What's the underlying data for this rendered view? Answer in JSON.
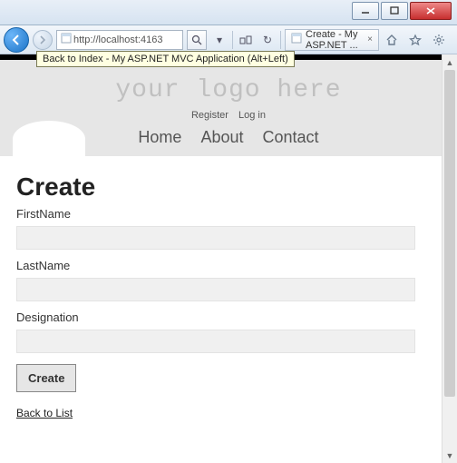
{
  "window": {
    "min": "—",
    "max": "□",
    "close": "×"
  },
  "toolbar": {
    "url": "http://localhost:4163",
    "search_glyph": "🔍",
    "refresh": "↻",
    "tab_title": "Create - My ASP.NET ...",
    "tab_close": "×",
    "tooltip": "Back to Index - My ASP.NET MVC Application (Alt+Left)"
  },
  "page": {
    "logo": "your logo here",
    "auth": {
      "register": "Register",
      "login": "Log in"
    },
    "nav": {
      "home": "Home",
      "about": "About",
      "contact": "Contact"
    },
    "title": "Create",
    "fields": {
      "first": "FirstName",
      "last": "LastName",
      "designation": "Designation"
    },
    "submit": "Create",
    "back": "Back to List"
  }
}
